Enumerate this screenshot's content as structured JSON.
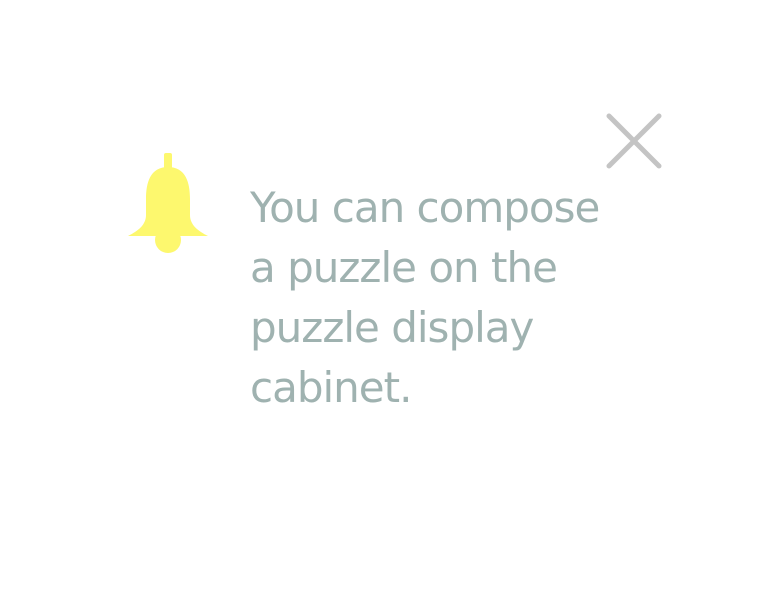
{
  "notification": {
    "icon": "bell-icon",
    "close_icon": "close-icon",
    "message_lines": [
      "You can compose",
      "a puzzle on the",
      "puzzle display",
      "cabinet."
    ]
  },
  "colors": {
    "bell": "#fdf86e",
    "text": "#9fb2b0",
    "close": "#c4c4c4",
    "background": "#ffffff"
  }
}
